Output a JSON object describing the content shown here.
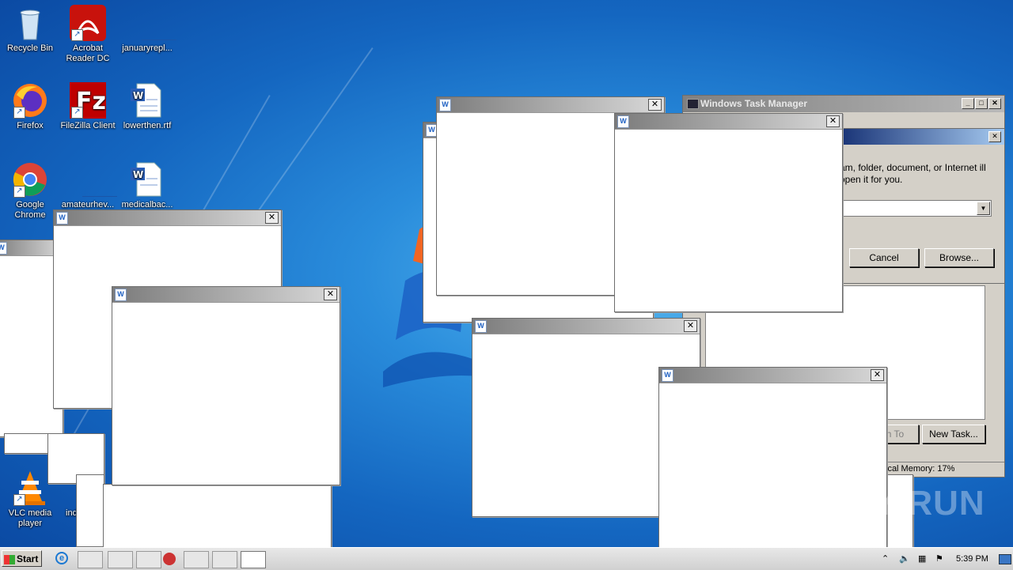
{
  "desktop_icons": [
    {
      "label": "Recycle Bin"
    },
    {
      "label": "Acrobat Reader DC"
    },
    {
      "label": "januaryrepl..."
    },
    {
      "label": "Firefox"
    },
    {
      "label": "FileZilla Client"
    },
    {
      "label": "lowerthen.rtf"
    },
    {
      "label": "Google Chrome"
    },
    {
      "label": "amateurhev..."
    },
    {
      "label": "medicalbac..."
    },
    {
      "label": "VLC media player"
    },
    {
      "label": "indu..."
    }
  ],
  "task_manager": {
    "title": "Windows Task Manager",
    "switch_to_label": "h To",
    "new_task_label": "New Task...",
    "status_text": "ical Memory: 17%"
  },
  "run_dialog": {
    "description": "am, folder, document, or Internet ill open it for you.",
    "cancel_label": "Cancel",
    "browse_label": "Browse..."
  },
  "word_window_icon_text": "W",
  "taskbar": {
    "start_label": "Start",
    "clock": "5:39 PM"
  },
  "watermark": "ANY RUN",
  "colors": {
    "desktop": "#1466c0",
    "titlebar_dark": "#7b7b7b",
    "titlebar_light": "#d9d9d9"
  }
}
